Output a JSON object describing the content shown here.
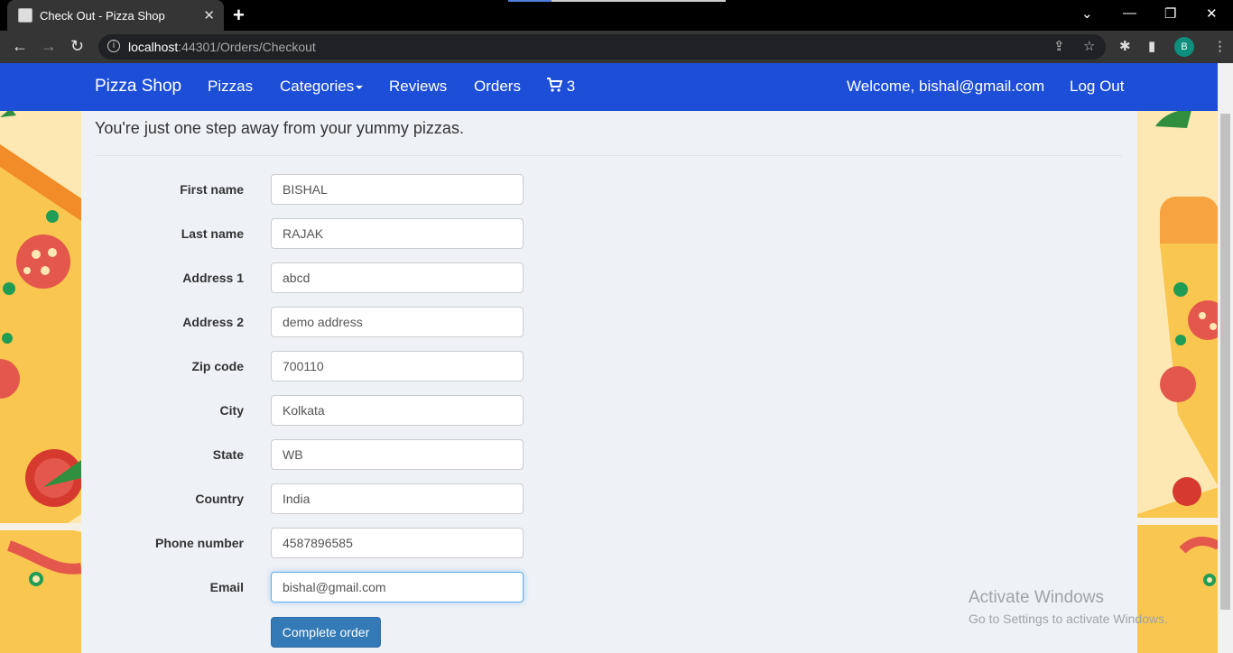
{
  "browser": {
    "tab_title": "Check Out - Pizza Shop",
    "url_host": "localhost",
    "url_path": ":44301/Orders/Checkout",
    "profile_initial": "B"
  },
  "navbar": {
    "brand": "Pizza Shop",
    "links": [
      "Pizzas",
      "Categories",
      "Reviews",
      "Orders"
    ],
    "cart_count": "3",
    "welcome": "Welcome, bishal@gmail.com",
    "logout": "Log Out"
  },
  "page": {
    "lead": "You're just one step away from your yummy pizzas.",
    "fields": [
      {
        "label": "First name",
        "value": "BISHAL"
      },
      {
        "label": "Last name",
        "value": "RAJAK"
      },
      {
        "label": "Address 1",
        "value": "abcd"
      },
      {
        "label": "Address 2",
        "value": "demo address"
      },
      {
        "label": "Zip code",
        "value": "700110"
      },
      {
        "label": "City",
        "value": "Kolkata"
      },
      {
        "label": "State",
        "value": "WB"
      },
      {
        "label": "Country",
        "value": "India"
      },
      {
        "label": "Phone number",
        "value": "4587896585"
      },
      {
        "label": "Email",
        "value": "bishal@gmail.com"
      }
    ],
    "submit": "Complete order"
  },
  "watermark": {
    "line1": "Activate Windows",
    "line2": "Go to Settings to activate Windows."
  },
  "colors": {
    "navbar": "#1d4ed8",
    "button": "#337ab7",
    "page_bg": "#fde7b2"
  }
}
